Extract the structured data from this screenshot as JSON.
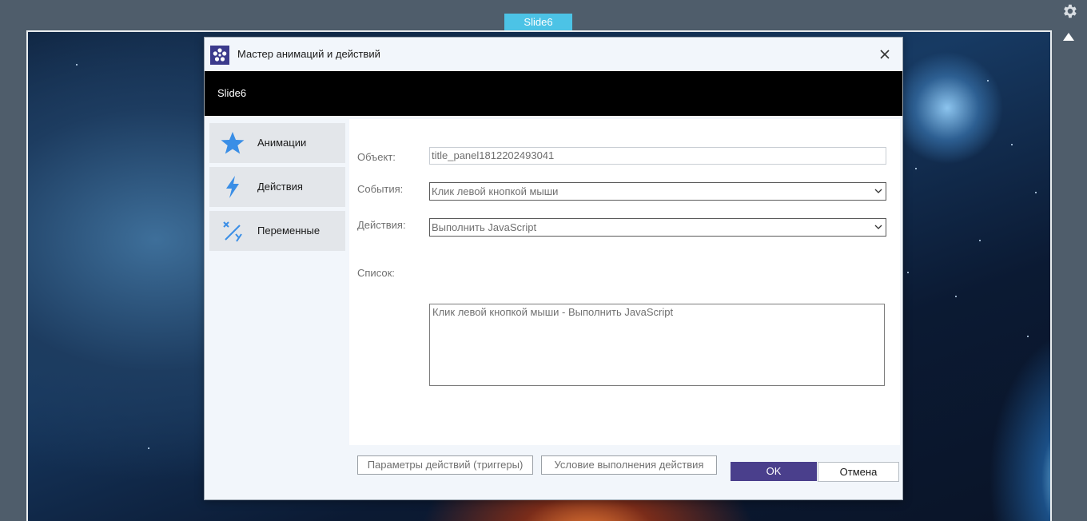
{
  "slide_tab": "Slide6",
  "icons": {
    "settings": "gear-icon",
    "collapse": "triangle-up-icon",
    "app": "app-logo-icon",
    "close": "close-icon",
    "animations": "star-icon",
    "actions": "lightning-icon",
    "variables": "variables-icon",
    "dropdown": "chevron-down-icon"
  },
  "dialog": {
    "title": "Мастер анимаций и действий",
    "header": "Slide6",
    "sidebar": {
      "items": [
        {
          "label": "Анимации"
        },
        {
          "label": "Действия"
        },
        {
          "label": "Переменные"
        }
      ]
    },
    "form": {
      "object_label": "Объект:",
      "object_value": "title_panel1812202493041",
      "events_label": "События:",
      "events_value": "Клик левой кнопкой мыши",
      "actions_label": "Действия:",
      "actions_value": "Выполнить JavaScript",
      "list_label": "Список:",
      "list_items": [
        "Клик левой кнопкой мыши - Выполнить JavaScript"
      ]
    },
    "buttons": {
      "triggers": "Параметры действий (триггеры)",
      "condition": "Условие выполнения действия",
      "ok": "OK",
      "cancel": "Отмена"
    }
  },
  "colors": {
    "accent": "#4a3f8c",
    "tab": "#4cc3e6",
    "icon_blue": "#3a8ee6"
  }
}
